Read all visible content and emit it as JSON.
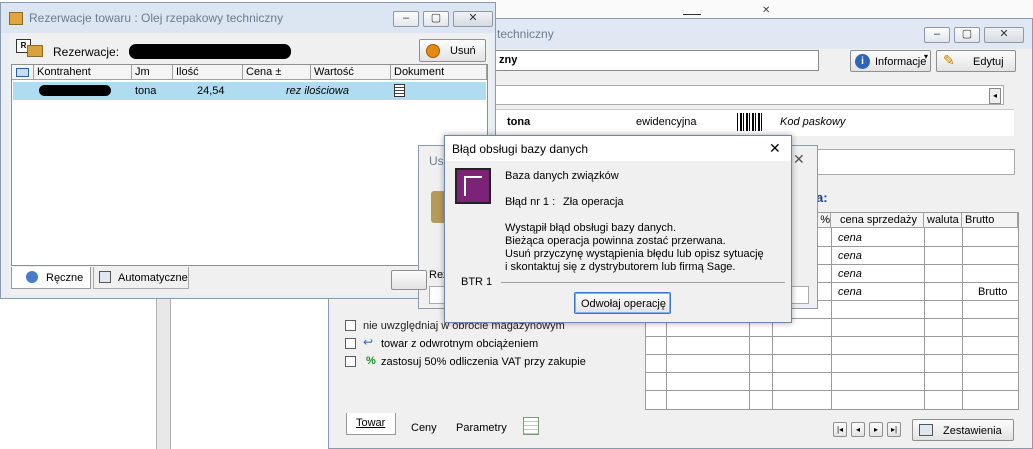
{
  "back_window": {
    "title": "techniczny",
    "name_value": "zny",
    "info_button": "Informacje",
    "edit_button": "Edytuj",
    "unit": "tona",
    "unit_type": "ewidencyjna",
    "barcode_label": "Kod paskowy",
    "section_letter": "a:",
    "columns": [
      "%",
      "cena sprzedaży",
      "waluta",
      "Brutto"
    ],
    "rows": [
      {
        "cena": "cena",
        "brutto": ""
      },
      {
        "cena": "cena",
        "brutto": ""
      },
      {
        "cena": "cena",
        "brutto": ""
      },
      {
        "cena": "cena",
        "brutto": "Brutto"
      }
    ],
    "options": [
      {
        "label": "nie uwzględniaj w obrocie magazynowym"
      },
      {
        "label": "towar z odwrotnym obciążeniem"
      },
      {
        "label": "zastosuj 50% odliczenia VAT przy zakupie"
      }
    ],
    "tabs": [
      "Towar",
      "Ceny",
      "Parametry"
    ],
    "report_button": "Zestawienia"
  },
  "reservation_window": {
    "title": "Rezerwacje towaru : Olej rzepakowy techniczny",
    "reservations_label": "Rezerwacje:",
    "delete_button": "Usuń",
    "columns": [
      "Kontrahent",
      "Jm",
      "Ilość",
      "Cena ±",
      "Wartość",
      "Dokument"
    ],
    "rows": [
      {
        "jm": "tona",
        "ilosc": "24,54",
        "wartosc": "rez ilościowa"
      }
    ],
    "tabs": [
      "Ręczne",
      "Automatyczne"
    ]
  },
  "middle_window": {
    "title": "Usu",
    "field_label": "Rez"
  },
  "error_dialog": {
    "title": "Błąd obsługi bazy danych",
    "source": "Baza danych związków",
    "error_label": "Błąd nr 1 :",
    "error_name": "Zła operacja",
    "message_lines": [
      "Wystąpił błąd obsługi bazy danych.",
      "Bieżąca operacja powinna zostać przerwana.",
      "Usuń przyczynę wystąpienia błędu lub opisz sytuację",
      "i skontaktuj się z dystrybutorem lub firmą Sage."
    ],
    "code": "BTR 1",
    "cancel_button": "Odwołaj operację"
  }
}
